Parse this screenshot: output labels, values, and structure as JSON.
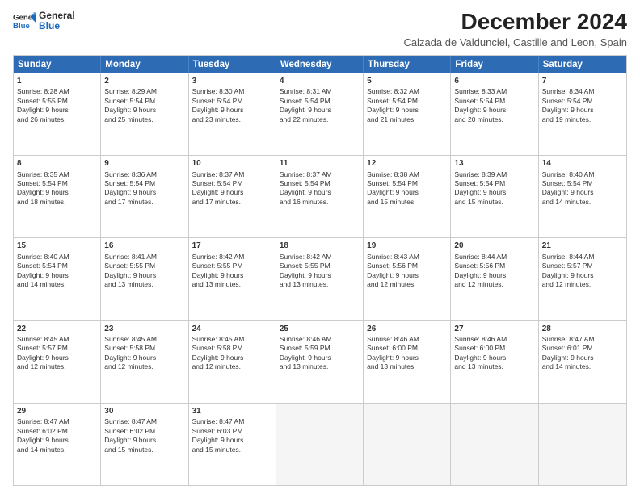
{
  "logo": {
    "line1": "General",
    "line2": "Blue"
  },
  "title": "December 2024",
  "subtitle": "Calzada de Valdunciel, Castille and Leon, Spain",
  "header_days": [
    "Sunday",
    "Monday",
    "Tuesday",
    "Wednesday",
    "Thursday",
    "Friday",
    "Saturday"
  ],
  "weeks": [
    [
      {
        "day": 1,
        "sr": "8:28 AM",
        "ss": "5:55 PM",
        "dl": "9 hours and 26 minutes."
      },
      {
        "day": 2,
        "sr": "8:29 AM",
        "ss": "5:54 PM",
        "dl": "9 hours and 25 minutes."
      },
      {
        "day": 3,
        "sr": "8:30 AM",
        "ss": "5:54 PM",
        "dl": "9 hours and 23 minutes."
      },
      {
        "day": 4,
        "sr": "8:31 AM",
        "ss": "5:54 PM",
        "dl": "9 hours and 22 minutes."
      },
      {
        "day": 5,
        "sr": "8:32 AM",
        "ss": "5:54 PM",
        "dl": "9 hours and 21 minutes."
      },
      {
        "day": 6,
        "sr": "8:33 AM",
        "ss": "5:54 PM",
        "dl": "9 hours and 20 minutes."
      },
      {
        "day": 7,
        "sr": "8:34 AM",
        "ss": "5:54 PM",
        "dl": "9 hours and 19 minutes."
      }
    ],
    [
      {
        "day": 8,
        "sr": "8:35 AM",
        "ss": "5:54 PM",
        "dl": "9 hours and 18 minutes."
      },
      {
        "day": 9,
        "sr": "8:36 AM",
        "ss": "5:54 PM",
        "dl": "9 hours and 17 minutes."
      },
      {
        "day": 10,
        "sr": "8:37 AM",
        "ss": "5:54 PM",
        "dl": "9 hours and 17 minutes."
      },
      {
        "day": 11,
        "sr": "8:37 AM",
        "ss": "5:54 PM",
        "dl": "9 hours and 16 minutes."
      },
      {
        "day": 12,
        "sr": "8:38 AM",
        "ss": "5:54 PM",
        "dl": "9 hours and 15 minutes."
      },
      {
        "day": 13,
        "sr": "8:39 AM",
        "ss": "5:54 PM",
        "dl": "9 hours and 15 minutes."
      },
      {
        "day": 14,
        "sr": "8:40 AM",
        "ss": "5:54 PM",
        "dl": "9 hours and 14 minutes."
      }
    ],
    [
      {
        "day": 15,
        "sr": "8:40 AM",
        "ss": "5:54 PM",
        "dl": "9 hours and 14 minutes."
      },
      {
        "day": 16,
        "sr": "8:41 AM",
        "ss": "5:55 PM",
        "dl": "9 hours and 13 minutes."
      },
      {
        "day": 17,
        "sr": "8:42 AM",
        "ss": "5:55 PM",
        "dl": "9 hours and 13 minutes."
      },
      {
        "day": 18,
        "sr": "8:42 AM",
        "ss": "5:55 PM",
        "dl": "9 hours and 13 minutes."
      },
      {
        "day": 19,
        "sr": "8:43 AM",
        "ss": "5:56 PM",
        "dl": "9 hours and 12 minutes."
      },
      {
        "day": 20,
        "sr": "8:44 AM",
        "ss": "5:56 PM",
        "dl": "9 hours and 12 minutes."
      },
      {
        "day": 21,
        "sr": "8:44 AM",
        "ss": "5:57 PM",
        "dl": "9 hours and 12 minutes."
      }
    ],
    [
      {
        "day": 22,
        "sr": "8:45 AM",
        "ss": "5:57 PM",
        "dl": "9 hours and 12 minutes."
      },
      {
        "day": 23,
        "sr": "8:45 AM",
        "ss": "5:58 PM",
        "dl": "9 hours and 12 minutes."
      },
      {
        "day": 24,
        "sr": "8:45 AM",
        "ss": "5:58 PM",
        "dl": "9 hours and 12 minutes."
      },
      {
        "day": 25,
        "sr": "8:46 AM",
        "ss": "5:59 PM",
        "dl": "9 hours and 13 minutes."
      },
      {
        "day": 26,
        "sr": "8:46 AM",
        "ss": "6:00 PM",
        "dl": "9 hours and 13 minutes."
      },
      {
        "day": 27,
        "sr": "8:46 AM",
        "ss": "6:00 PM",
        "dl": "9 hours and 13 minutes."
      },
      {
        "day": 28,
        "sr": "8:47 AM",
        "ss": "6:01 PM",
        "dl": "9 hours and 14 minutes."
      }
    ],
    [
      {
        "day": 29,
        "sr": "8:47 AM",
        "ss": "6:02 PM",
        "dl": "9 hours and 14 minutes."
      },
      {
        "day": 30,
        "sr": "8:47 AM",
        "ss": "6:02 PM",
        "dl": "9 hours and 15 minutes."
      },
      {
        "day": 31,
        "sr": "8:47 AM",
        "ss": "6:03 PM",
        "dl": "9 hours and 15 minutes."
      },
      null,
      null,
      null,
      null
    ]
  ],
  "labels": {
    "sunrise": "Sunrise:",
    "sunset": "Sunset:",
    "daylight": "Daylight:"
  }
}
